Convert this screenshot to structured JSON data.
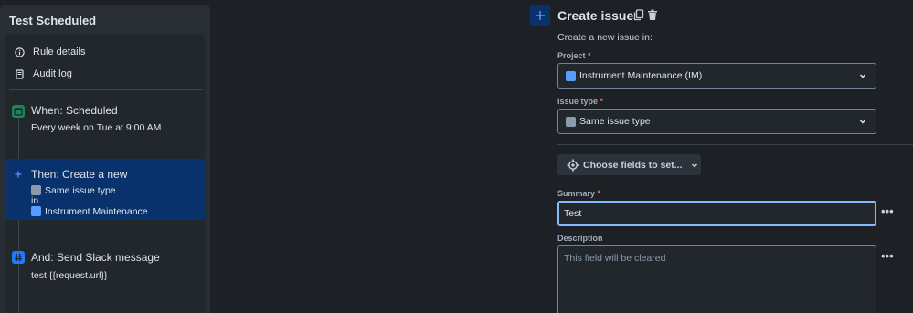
{
  "rule": {
    "title": "Test Scheduled"
  },
  "nav": [
    {
      "label": "Rule details",
      "icon": "info-icon"
    },
    {
      "label": "Audit log",
      "icon": "document-icon"
    }
  ],
  "steps": {
    "trigger": {
      "title": "When: Scheduled",
      "detail": "Every week on Tue at 9:00 AM",
      "icon": "calendar-icon",
      "color": "#1f845a"
    },
    "action": {
      "title": "Then: Create a new",
      "issue_type": "Same issue type",
      "connector": "in",
      "project": "Instrument Maintenance",
      "icon": "plus-icon",
      "color": "#579dff"
    },
    "slack": {
      "title": "And: Send Slack message",
      "detail": "test {{request.url}}",
      "icon": "slack-icon",
      "color": "#1d7afc"
    }
  },
  "editor": {
    "title": "Create issue",
    "subtitle": "Create a new issue in:",
    "project_label": "Project",
    "project_value": "Instrument Maintenance (IM)",
    "issue_type_label": "Issue type",
    "issue_type_value": "Same issue type",
    "choose_fields_label": "Choose fields to set...",
    "summary_label": "Summary",
    "summary_value": "Test",
    "description_label": "Description",
    "description_placeholder": "This field will be cleared",
    "required_mark": "*",
    "more_label": "•••"
  },
  "colors": {
    "background": "#1d2125",
    "panel": "#282e33",
    "selected": "#09326c",
    "focus_border": "#85b8ff",
    "required": "#f87168"
  }
}
